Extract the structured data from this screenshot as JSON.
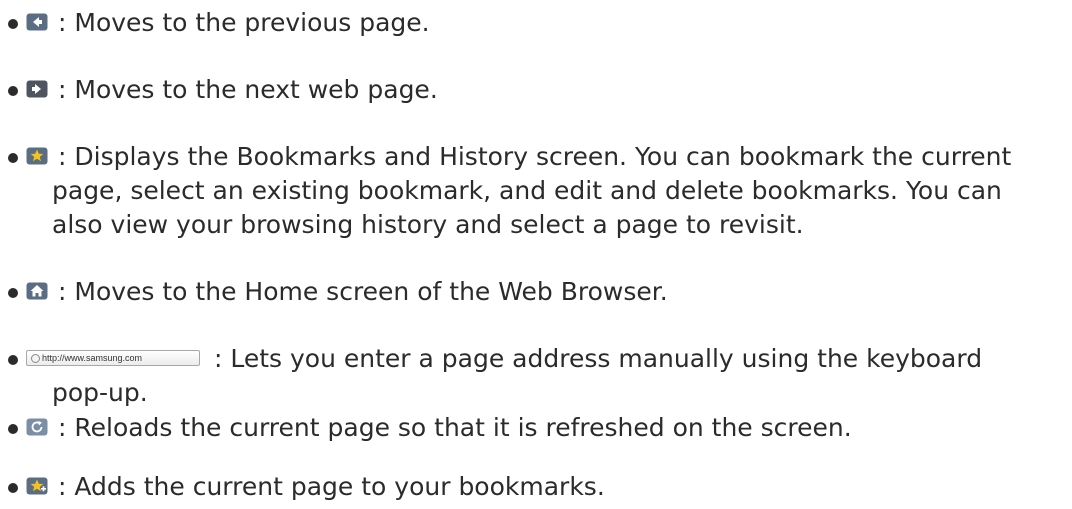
{
  "items": [
    {
      "icon": "back-arrow-icon",
      "lines": [
        ": Moves to the previous page."
      ]
    },
    {
      "icon": "forward-arrow-icon",
      "lines": [
        ": Moves to the next web page."
      ]
    },
    {
      "icon": "bookmark-star-icon",
      "lines": [
        ": Displays the Bookmarks and History screen. You can bookmark the current",
        "page, select an existing bookmark, and edit and delete bookmarks. You can",
        "also view your browsing history and select a page to revisit."
      ]
    },
    {
      "icon": "home-icon",
      "lines": [
        ": Moves to the Home screen of the Web Browser."
      ]
    },
    {
      "icon": "url-field-icon",
      "url": "http://www.samsung.com",
      "lines": [
        ": Lets you enter a page address manually using the keyboard",
        "pop-up."
      ]
    },
    {
      "icon": "reload-icon",
      "lines": [
        ": Reloads the current page so that it is refreshed on the screen."
      ]
    },
    {
      "icon": "add-bookmark-icon",
      "lines": [
        ": Adds the current page to your bookmarks."
      ]
    }
  ],
  "colors": {
    "text": "#2b2b2b",
    "icon_bg": "#5a6d82",
    "star": "#f4c21b"
  }
}
